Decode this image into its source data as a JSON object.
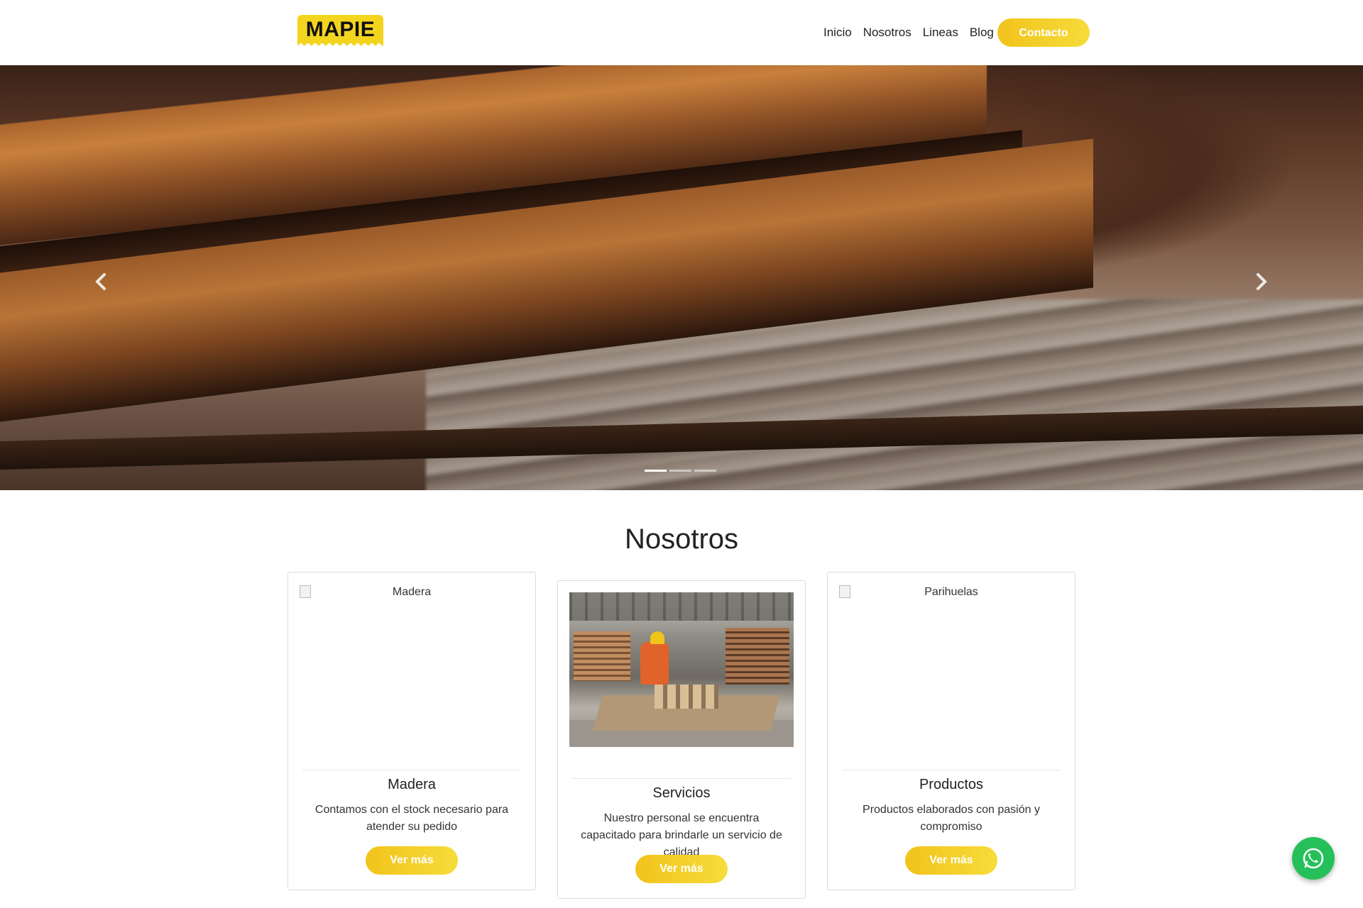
{
  "header": {
    "logo_text": "MAPIE",
    "nav": [
      {
        "label": "Inicio"
      },
      {
        "label": "Nosotros"
      },
      {
        "label": "Lineas"
      },
      {
        "label": "Blog"
      }
    ],
    "cta_label": "Contacto"
  },
  "hero": {
    "prev_icon": "chevron-left-icon",
    "next_icon": "chevron-right-icon",
    "slides_count": 3,
    "active_slide": 1
  },
  "section": {
    "title": "Nosotros",
    "cards": [
      {
        "image_alt": "Madera",
        "title": "Madera",
        "description": "Contamos con el stock necesario para atender su pedido",
        "button": "Ver más"
      },
      {
        "image_alt": "",
        "title": "Servicios",
        "description": "Nuestro personal se encuentra capacitado para brindarle un servicio de calidad",
        "button": "Ver más"
      },
      {
        "image_alt": "Parihuelas",
        "title": "Productos",
        "description": "Productos elaborados con pasión y compromiso",
        "button": "Ver más"
      }
    ]
  },
  "colors": {
    "accent": "#f2c31c",
    "whatsapp": "#25c05a"
  },
  "floating": {
    "whatsapp_icon": "whatsapp-icon"
  }
}
